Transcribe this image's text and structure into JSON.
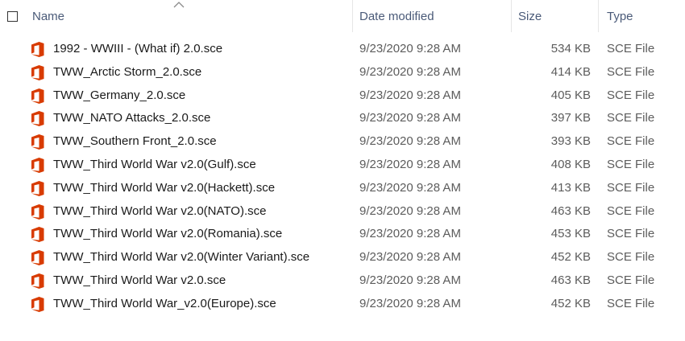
{
  "header": {
    "name_label": "Name",
    "date_label": "Date modified",
    "size_label": "Size",
    "type_label": "Type",
    "sort_direction": "ascending",
    "select_all_checked": false
  },
  "icon": {
    "name": "office-file-icon",
    "color": "#d83b01"
  },
  "files": [
    {
      "name": "1992 - WWIII - (What if) 2.0.sce",
      "date": "9/23/2020 9:28 AM",
      "size": "534 KB",
      "type": "SCE File"
    },
    {
      "name": "TWW_Arctic Storm_2.0.sce",
      "date": "9/23/2020 9:28 AM",
      "size": "414 KB",
      "type": "SCE File"
    },
    {
      "name": "TWW_Germany_2.0.sce",
      "date": "9/23/2020 9:28 AM",
      "size": "405 KB",
      "type": "SCE File"
    },
    {
      "name": "TWW_NATO Attacks_2.0.sce",
      "date": "9/23/2020 9:28 AM",
      "size": "397 KB",
      "type": "SCE File"
    },
    {
      "name": "TWW_Southern Front_2.0.sce",
      "date": "9/23/2020 9:28 AM",
      "size": "393 KB",
      "type": "SCE File"
    },
    {
      "name": "TWW_Third World War v2.0(Gulf).sce",
      "date": "9/23/2020 9:28 AM",
      "size": "408 KB",
      "type": "SCE File"
    },
    {
      "name": "TWW_Third World War v2.0(Hackett).sce",
      "date": "9/23/2020 9:28 AM",
      "size": "413 KB",
      "type": "SCE File"
    },
    {
      "name": "TWW_Third World War v2.0(NATO).sce",
      "date": "9/23/2020 9:28 AM",
      "size": "463 KB",
      "type": "SCE File"
    },
    {
      "name": "TWW_Third World War v2.0(Romania).sce",
      "date": "9/23/2020 9:28 AM",
      "size": "453 KB",
      "type": "SCE File"
    },
    {
      "name": "TWW_Third World War v2.0(Winter Variant).sce",
      "date": "9/23/2020 9:28 AM",
      "size": "452 KB",
      "type": "SCE File"
    },
    {
      "name": "TWW_Third World War v2.0.sce",
      "date": "9/23/2020 9:28 AM",
      "size": "463 KB",
      "type": "SCE File"
    },
    {
      "name": "TWW_Third World War_v2.0(Europe).sce",
      "date": "9/23/2020 9:28 AM",
      "size": "452 KB",
      "type": "SCE File"
    }
  ]
}
